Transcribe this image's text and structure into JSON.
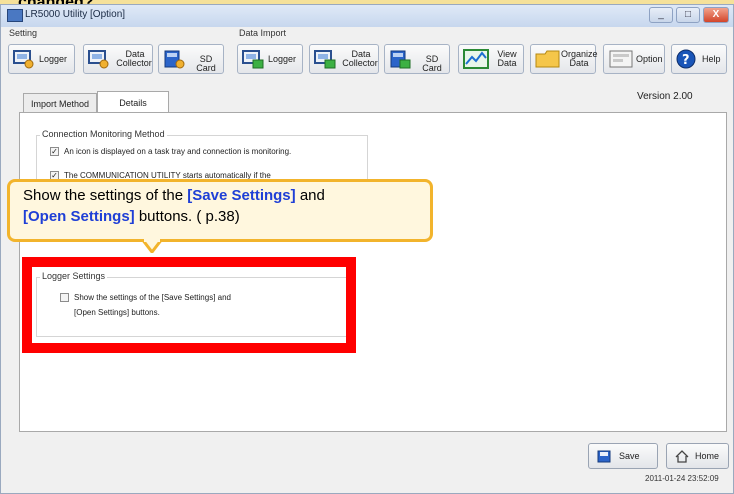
{
  "banner_text": "changed?",
  "window": {
    "title": "LR5000 Utility [Option]",
    "minimize_label": "_",
    "maximize_label": "□",
    "close_label": "X"
  },
  "toolbar": {
    "setting_group": "Setting",
    "data_import_group": "Data Import",
    "setting_logger": "Logger",
    "setting_data_collector_1": "Data",
    "setting_data_collector_2": "Collector",
    "setting_sd_card": "SD Card",
    "import_logger": "Logger",
    "import_data_collector_1": "Data",
    "import_data_collector_2": "Collector",
    "import_sd_card": "SD Card",
    "view_data_1": "View",
    "view_data_2": "Data",
    "organize_data_1": "Organize",
    "organize_data_2": "Data",
    "option": "Option",
    "help": "Help"
  },
  "version": "Version   2.00",
  "tabs": [
    "Import Method",
    "Details"
  ],
  "connection": {
    "legend": "Connection Monitoring Method",
    "opt1": "An icon is displayed on a task tray and connection is monitoring.",
    "opt2": "The COMMUNICATION UTILITY starts automatically if the"
  },
  "logger_settings": {
    "legend": "Logger Settings",
    "opt_line1": "Show the settings of the [Save Settings] and",
    "opt_line2": "[Open Settings] buttons."
  },
  "callout": {
    "pre": "Show the settings of the ",
    "save": "[Save Settings]",
    "and": " and",
    "open": "[Open Settings]",
    "post": " buttons. ( p.38)"
  },
  "buttons": {
    "save": "Save",
    "home": "Home"
  },
  "timestamp": "2011-01-24 23:52:09",
  "colors": {
    "highlight_blue": "#1f3fd6",
    "callout_border": "#f2b42c",
    "red_box": "#ff0000"
  }
}
